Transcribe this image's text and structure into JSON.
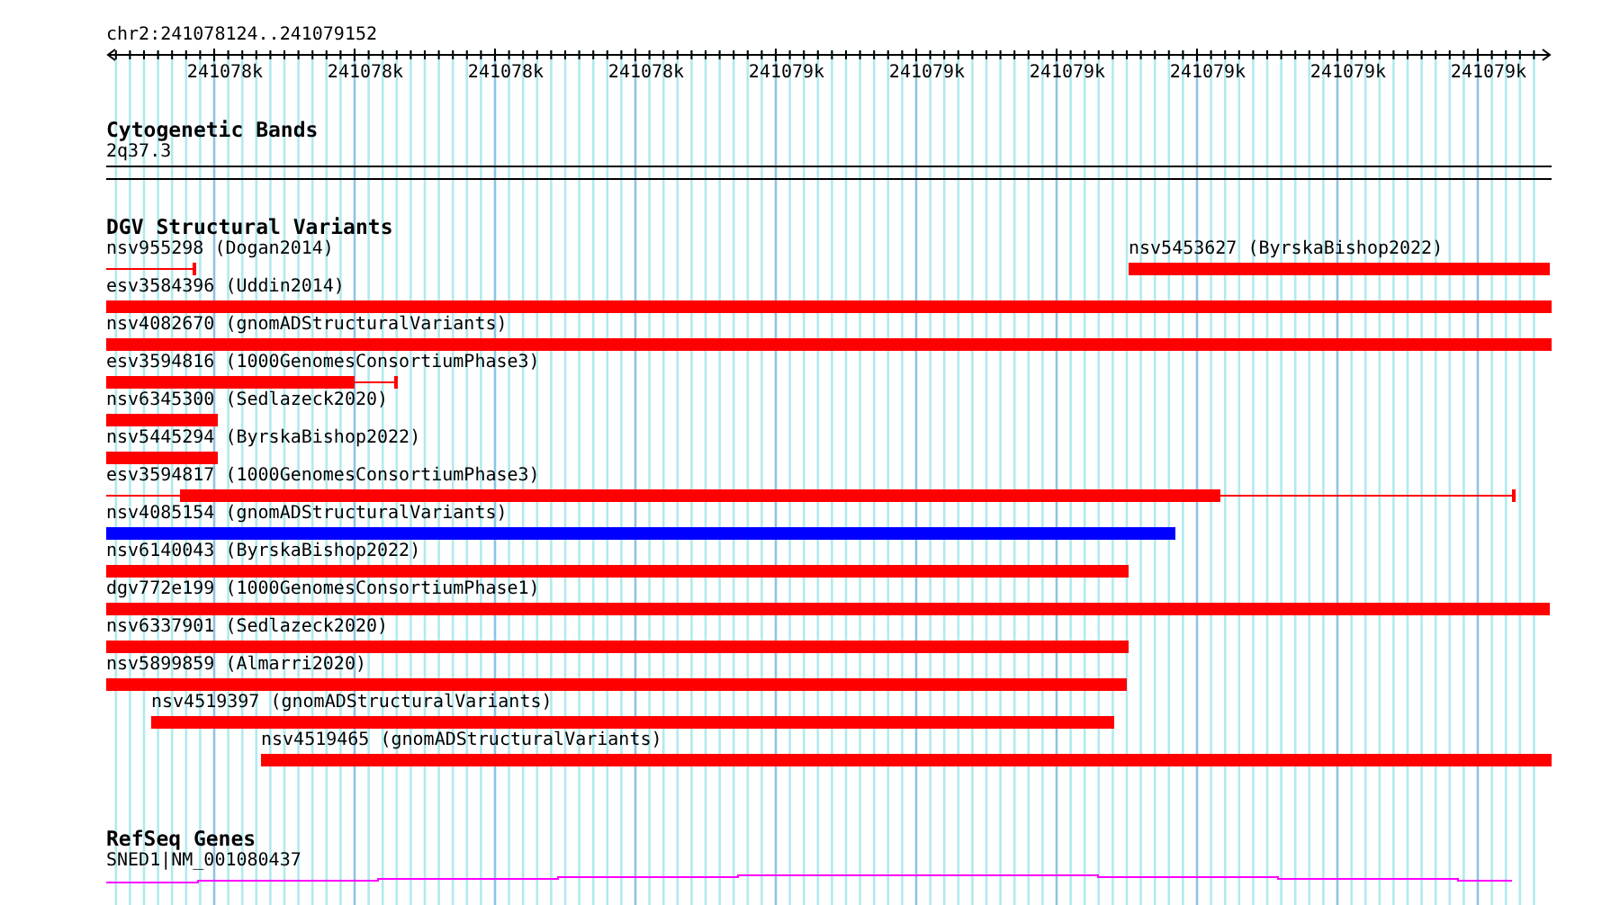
{
  "location": "chr2:241078124..241079152",
  "ruler": {
    "tick_labels": [
      "241078k",
      "241078k",
      "241078k",
      "241078k",
      "241079k",
      "241079k",
      "241079k",
      "241079k",
      "241079k",
      "241079k"
    ]
  },
  "cytogenetic_bands": {
    "title": "Cytogenetic Bands",
    "label": "2q37.3"
  },
  "dgv_structural_variants": {
    "title": "DGV Structural Variants",
    "rows": [
      {
        "features": [
          {
            "label": "nsv955298 (Dogan2014)",
            "color": "#ff0000"
          },
          {
            "label": "nsv5453627 (ByrskaBishop2022)",
            "color": "#ff0000"
          }
        ]
      },
      {
        "features": [
          {
            "label": "esv3584396 (Uddin2014)",
            "color": "#ff0000"
          }
        ]
      },
      {
        "features": [
          {
            "label": "nsv4082670 (gnomADStructuralVariants)",
            "color": "#ff0000"
          }
        ]
      },
      {
        "features": [
          {
            "label": "esv3594816 (1000GenomesConsortiumPhase3)",
            "color": "#ff0000"
          }
        ]
      },
      {
        "features": [
          {
            "label": "nsv6345300 (Sedlazeck2020)",
            "color": "#ff0000"
          }
        ]
      },
      {
        "features": [
          {
            "label": "nsv5445294 (ByrskaBishop2022)",
            "color": "#ff0000"
          }
        ]
      },
      {
        "features": [
          {
            "label": "esv3594817 (1000GenomesConsortiumPhase3)",
            "color": "#ff0000"
          }
        ]
      },
      {
        "features": [
          {
            "label": "nsv4085154 (gnomADStructuralVariants)",
            "color": "#0000ff"
          }
        ]
      },
      {
        "features": [
          {
            "label": "nsv6140043 (ByrskaBishop2022)",
            "color": "#ff0000"
          }
        ]
      },
      {
        "features": [
          {
            "label": "dgv772e199 (1000GenomesConsortiumPhase1)",
            "color": "#ff0000"
          }
        ]
      },
      {
        "features": [
          {
            "label": "nsv6337901 (Sedlazeck2020)",
            "color": "#ff0000"
          }
        ]
      },
      {
        "features": [
          {
            "label": "nsv5899859 (Almarri2020)",
            "color": "#ff0000"
          }
        ]
      },
      {
        "features": [
          {
            "label": "nsv4519397 (gnomADStructuralVariants)",
            "color": "#ff0000"
          }
        ]
      },
      {
        "features": [
          {
            "label": "nsv4519465 (gnomADStructuralVariants)",
            "color": "#ff0000"
          }
        ]
      }
    ]
  },
  "refseq_genes": {
    "title": "RefSeq Genes",
    "label": "SNED1|NM_001080437"
  }
}
